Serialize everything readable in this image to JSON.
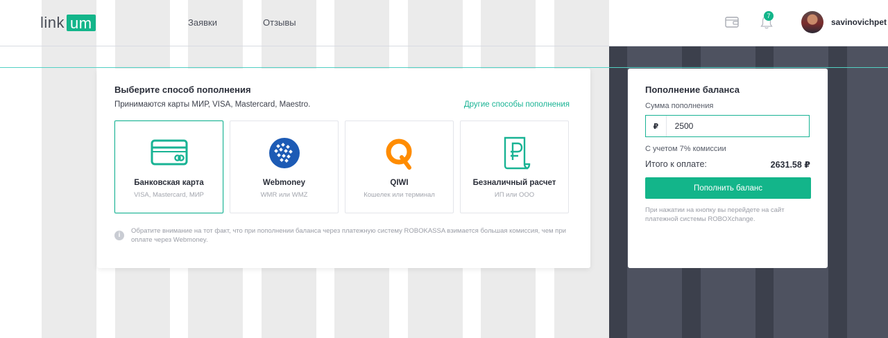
{
  "header": {
    "logo_text": "link",
    "logo_badge": "um",
    "nav": [
      "Заявки",
      "Отзывы"
    ],
    "notifications_count": "7",
    "username": "savinovichpet",
    "icons": [
      "wallet-icon",
      "bell-icon"
    ]
  },
  "method": {
    "title": "Выберите способ пополнения",
    "subtitle": "Принимаются карты МИР, VISA, Mastercard, Maestro.",
    "other_link": "Другие способы пополнения",
    "options": [
      {
        "title": "Банковская карта",
        "sub": "VISA, Mastercard, МИР",
        "icon": "bank-card-icon",
        "selected": true
      },
      {
        "title": "Webmoney",
        "sub": "WMR или WMZ",
        "icon": "webmoney-icon",
        "selected": false
      },
      {
        "title": "QIWI",
        "sub": "Кошелек или терминал",
        "icon": "qiwi-icon",
        "selected": false
      },
      {
        "title": "Безналичный расчет",
        "sub": "ИП или ООО",
        "icon": "ruble-invoice-icon",
        "selected": false
      }
    ],
    "notice": "Обратите внимание на тот факт, что при пополнении баланса через платежную систему ROBOKASSA взимается большая комиссия, чем при оплате через Webmoney."
  },
  "balance": {
    "title": "Пополнение баланса",
    "amount_label": "Сумма пополнения",
    "currency_symbol": "₽",
    "amount_value": "2500",
    "commission": "С учетом 7% комиссии",
    "total_label": "Итого к оплате:",
    "total_value": "2631.58 ₽",
    "button": "Пополнить баланс",
    "disclaimer": "При нажатии на кнопку вы перейдете на сайт платежной системы ROBOXchange."
  },
  "colors": {
    "accent": "#13b58a",
    "accent_text": "#19b394",
    "dark_panel": "#3c404c",
    "guide_line": "#53d1c4"
  }
}
